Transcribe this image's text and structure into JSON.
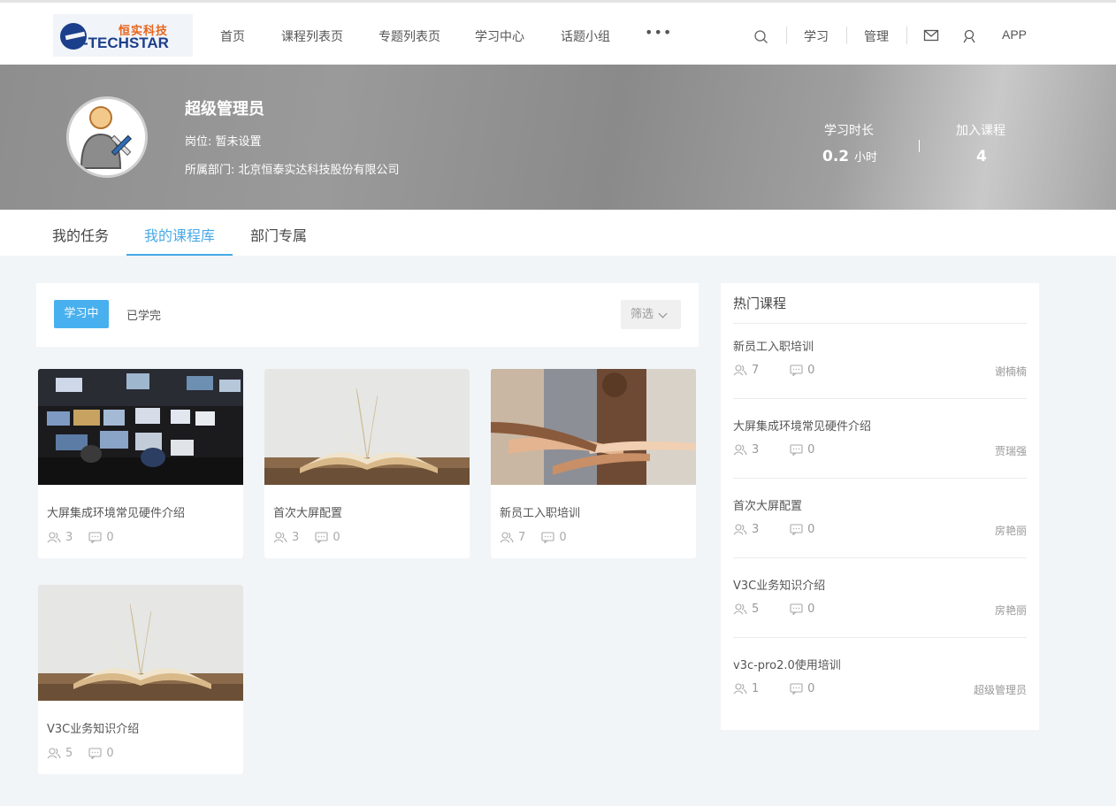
{
  "logo": {
    "cn_text": "恒实科技",
    "en_text": "-TECHSTAR"
  },
  "nav": {
    "items": [
      "首页",
      "课程列表页",
      "专题列表页",
      "学习中心",
      "话题小组"
    ],
    "more_label": "•••",
    "right": {
      "study": "学习",
      "manage": "管理",
      "app": "APP"
    }
  },
  "profile": {
    "name": "超级管理员",
    "position": "岗位: 暂未设置",
    "department": "所属部门: 北京恒泰实达科技股份有限公司",
    "stats": {
      "study_time_label": "学习时长",
      "study_time_value": "0.2",
      "study_time_unit": "小时",
      "courses_label": "加入课程",
      "courses_value": "4"
    }
  },
  "tabs": [
    "我的任务",
    "我的课程库",
    "部门专属"
  ],
  "active_tab_index": 1,
  "filter": {
    "learning": "学习中",
    "finished": "已学完",
    "filter_button": "筛选"
  },
  "courses": [
    {
      "title": "大屏集成环境常见硬件介绍",
      "learners": "3",
      "comments": "0",
      "thumb": "control-room"
    },
    {
      "title": "首次大屏配置",
      "learners": "3",
      "comments": "0",
      "thumb": "open-book"
    },
    {
      "title": "新员工入职培训",
      "learners": "7",
      "comments": "0",
      "thumb": "team-hands"
    },
    {
      "title": "V3C业务知识介绍",
      "learners": "5",
      "comments": "0",
      "thumb": "open-book"
    }
  ],
  "hot": {
    "title": "热门课程",
    "items": [
      {
        "title": "新员工入职培训",
        "learners": "7",
        "comments": "0",
        "author": "谢楠楠"
      },
      {
        "title": "大屏集成环境常见硬件介绍",
        "learners": "3",
        "comments": "0",
        "author": "贾瑞强"
      },
      {
        "title": "首次大屏配置",
        "learners": "3",
        "comments": "0",
        "author": "房艳丽"
      },
      {
        "title": "V3C业务知识介绍",
        "learners": "5",
        "comments": "0",
        "author": "房艳丽"
      },
      {
        "title": "v3c-pro2.0使用培训",
        "learners": "1",
        "comments": "0",
        "author": "超级管理员"
      }
    ]
  },
  "colors": {
    "accent": "#48a9e6",
    "banner_gray": "#9a9a9a"
  }
}
